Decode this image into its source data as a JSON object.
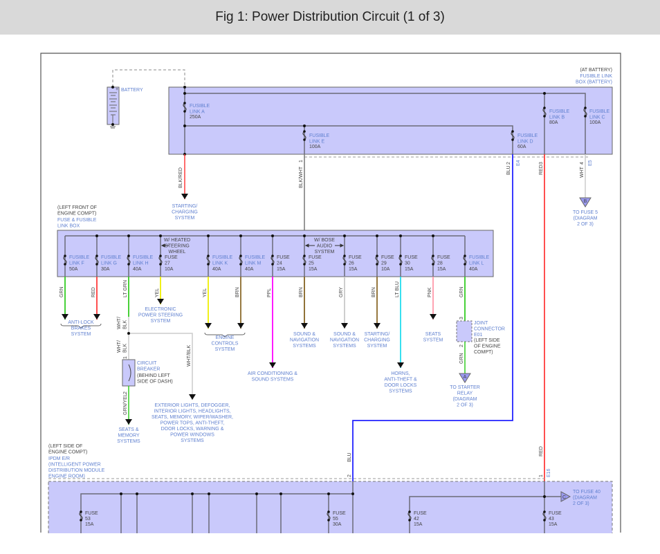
{
  "title": "Fig 1: Power Distribution Circuit (1 of 3)",
  "colors": {
    "box_fill": "#c9c9fb",
    "wire_red": "#ff3b3b",
    "wire_blue": "#2222ff",
    "wire_green": "#33cc22",
    "wire_yellow": "#eeee00",
    "wire_brown": "#8b6a2a",
    "wire_purple": "#ff00ff",
    "wire_cyan": "#22ddee",
    "wire_pink": "#ff99aa",
    "wire_gray": "#c8c8c8",
    "label_text": "#5e7fcf"
  },
  "battery": {
    "label": "BATTERY",
    "plus": "+",
    "minus": "-"
  },
  "top_box": {
    "location": [
      "(AT BATTERY)"
    ],
    "name": [
      "FUSIBLE LINK",
      "BOX (BATTERY)"
    ],
    "links": [
      {
        "name": [
          "FUSIBLE",
          "LINK A"
        ],
        "rating": "250A"
      },
      {
        "name": [
          "FUSIBLE",
          "LINK E"
        ],
        "rating": "100A"
      },
      {
        "name": [
          "FUSIBLE",
          "LINK D"
        ],
        "rating": "60A"
      },
      {
        "name": [
          "FUSIBLE",
          "LINK B"
        ],
        "rating": "80A"
      },
      {
        "name": [
          "FUSIBLE",
          "LINK C"
        ],
        "rating": "100A"
      }
    ],
    "pins": {
      "e": "1",
      "d": "2",
      "b": "3",
      "c": "4"
    },
    "connectors": {
      "d": "E4",
      "c": "E5"
    },
    "wires": {
      "a": "BLK/RED",
      "e": "BLK/WHT",
      "d": "BLU",
      "b": "RED",
      "c": "WHT"
    }
  },
  "starting_charging_1": [
    "STARTING/",
    "CHARGING",
    "SYSTEM"
  ],
  "to_fuse_5": {
    "symbol": "B",
    "text": [
      "TO FUSE 5",
      "(DIAGRAM",
      "2 OF 3)"
    ]
  },
  "fuse_box": {
    "location": [
      "(LEFT FRONT OF",
      "ENGINE COMPT)"
    ],
    "name": [
      "FUSE & FUSIBLE",
      "LINK BOX"
    ],
    "heated_note": [
      "W/ HEATED",
      "STEERING",
      "WHEEL"
    ],
    "bose_note": [
      "W/ BOSE",
      "AUDIO",
      "SYSTEM"
    ],
    "fuses": [
      {
        "name": [
          "FUSIBLE",
          "LINK F"
        ],
        "rating": "50A",
        "wire": "GRN"
      },
      {
        "name": [
          "FUSIBLE",
          "LINK G"
        ],
        "rating": "30A",
        "wire": "RED"
      },
      {
        "name": [
          "FUSIBLE",
          "LINK H"
        ],
        "rating": "40A",
        "wire": "LT GRN"
      },
      {
        "name": [
          "FUSE",
          "27"
        ],
        "rating": "10A",
        "wire": "YEL"
      },
      {
        "name": [
          "FUSIBLE",
          "LINK K"
        ],
        "rating": "40A",
        "wire": "YEL"
      },
      {
        "name": [
          "FUSIBLE",
          "LINK M"
        ],
        "rating": "40A",
        "wire": "BRN"
      },
      {
        "name": [
          "FUSE",
          "24"
        ],
        "rating": "15A",
        "wire": "PPL"
      },
      {
        "name": [
          "FUSE",
          "25"
        ],
        "rating": "15A",
        "wire": "BRN"
      },
      {
        "name": [
          "FUSE",
          "26"
        ],
        "rating": "15A",
        "wire": "GRY"
      },
      {
        "name": [
          "FUSE",
          "29"
        ],
        "rating": "10A",
        "wire": "BRN"
      },
      {
        "name": [
          "FUSE",
          "30"
        ],
        "rating": "15A",
        "wire": "LT BLU"
      },
      {
        "name": [
          "FUSE",
          "28"
        ],
        "rating": "15A",
        "wire": "PNK"
      },
      {
        "name": [
          "FUSIBLE",
          "LINK L"
        ],
        "rating": "40A",
        "wire": "GRN"
      }
    ]
  },
  "destinations": {
    "abs": [
      "ANTI-LOCK",
      "BRAKES",
      "SYSTEM"
    ],
    "eps": [
      "ELECTRONIC",
      "POWER STEERING",
      "SYSTEM"
    ],
    "engine": [
      "ENGINE",
      "CONTROLS",
      "SYSTEM"
    ],
    "ac": [
      "AIR CONDITIONING &",
      "SOUND SYSTEMS"
    ],
    "sound1": [
      "SOUND &",
      "NAVIGATION",
      "SYSTEMS"
    ],
    "sound2": [
      "SOUND &",
      "NAVIGATION",
      "SYSTEMS"
    ],
    "starting2": [
      "STARTING/",
      "CHARGING",
      "SYSTEM"
    ],
    "horns": [
      "HORNS,",
      "ANTI-THEFT &",
      "DOOR LOCKS",
      "SYSTEMS"
    ],
    "seats": [
      "SEATS",
      "SYSTEM"
    ],
    "seats_memory": [
      "SEATS &",
      "MEMORY",
      "SYSTEMS"
    ],
    "exterior": [
      "EXTERIOR LIGHTS, DEFOGGER,",
      "INTERIOR LIGHTS, HEADLIGHTS,",
      "SEATS, MEMORY, WIPER/WASHER,",
      "POWER TOPS, ANTI-THEFT,",
      "DOOR LOCKS, WARNING &",
      "POWER WINDOWS",
      "SYSTEMS"
    ]
  },
  "breaker": {
    "name": [
      "CIRCUIT",
      "BREAKER"
    ],
    "location": [
      "(BEHIND LEFT",
      "SIDE OF DASH)"
    ],
    "pin1": "1",
    "pin2": "2",
    "wire_in_1": [
      "WHT/",
      "BLK"
    ],
    "wire_in_2": [
      "WHT/",
      "BLK"
    ],
    "wire_out": "GRN/YEL",
    "branch_wire": "WHT/BLK"
  },
  "joint": {
    "name": [
      "JOINT",
      "CONNECTOR",
      "E01"
    ],
    "location": [
      "(LEFT SIDE",
      "OF ENGINE",
      "COMPT)"
    ],
    "pin_top": "3",
    "pin_bottom": "2",
    "wire_out": "GRN"
  },
  "to_starter": {
    "symbol": "A",
    "text": [
      "TO STARTER",
      "RELAY",
      "(DIAGRAM",
      "2 OF 3)"
    ]
  },
  "ipdm": {
    "location": [
      "(LEFT SIDE OF",
      "ENGINE COMPT)"
    ],
    "name": [
      "IPDM E/R",
      "(INTELLIGENT POWER",
      "DISTRIBUTION MODULE",
      "ENGINE ROOM)"
    ],
    "blu_wire": "BLU",
    "blu_pin": "2",
    "red_wire": "RED",
    "red_pin": "1",
    "red_connector": "E16",
    "fuses": [
      {
        "name": "FUSE",
        "num": "53",
        "rating": "15A"
      },
      {
        "name": "FUSE",
        "num": "55",
        "rating": "30A"
      },
      {
        "name": "FUSE",
        "num": "42",
        "rating": "15A"
      },
      {
        "name": "FUSE",
        "num": "43",
        "rating": "15A"
      }
    ],
    "to_fuse_40": {
      "symbol": "C",
      "text": [
        "TO FUSE 40",
        "(DIAGRAM",
        "2 OF 3)"
      ]
    }
  }
}
